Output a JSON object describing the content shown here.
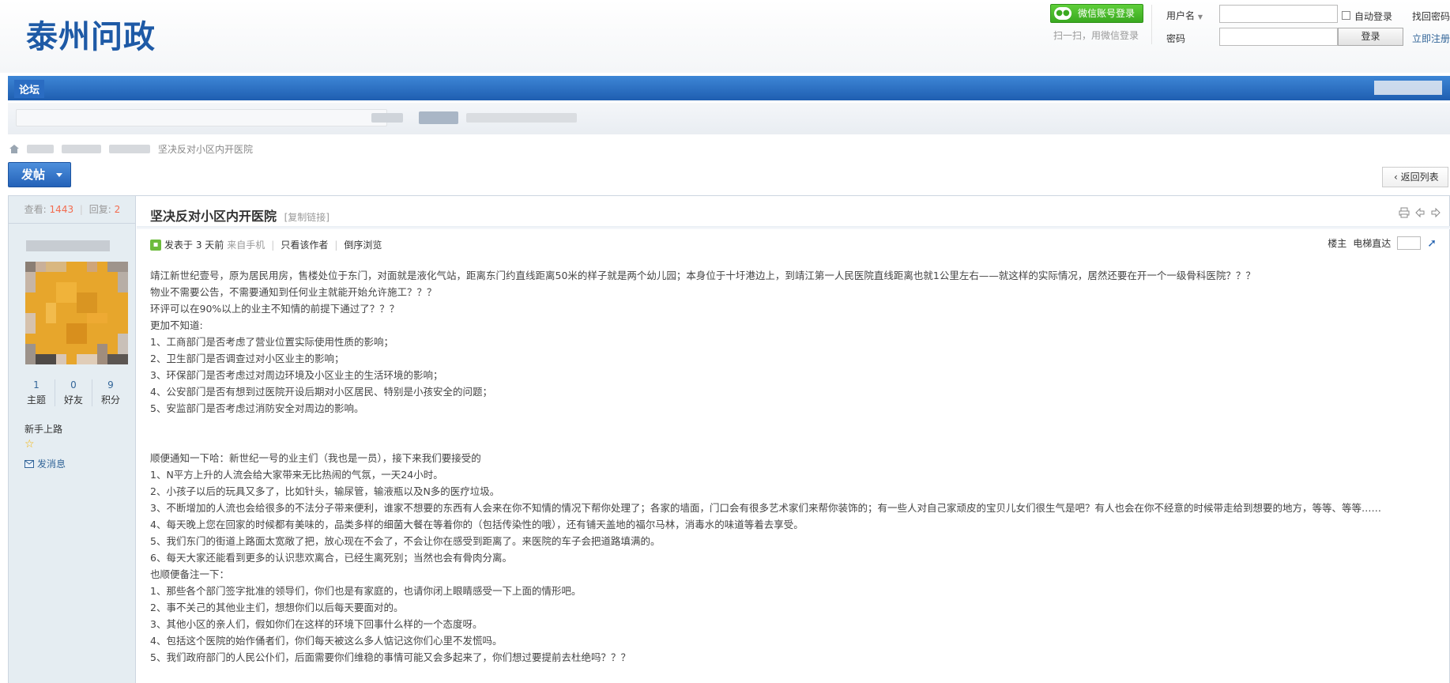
{
  "header": {
    "logo": "泰州问政",
    "wechat_login": "微信账号登录",
    "wechat_hint": "扫一扫，用微信登录",
    "username_label": "用户名",
    "password_label": "密码",
    "auto_login": "自动登录",
    "forgot_password": "找回密码",
    "login_button": "登录",
    "register": "立即注册"
  },
  "nav": {
    "forum": "论坛"
  },
  "breadcrumb": {
    "current": "坚决反对小区内开医院"
  },
  "toolbar": {
    "post_button": "发帖",
    "back_button": "返回列表"
  },
  "stats": {
    "views_label": "查看:",
    "views": "1443",
    "replies_label": "回复:",
    "replies": "2"
  },
  "author": {
    "counts": [
      {
        "value": "1",
        "label": "主题"
      },
      {
        "value": "0",
        "label": "好友"
      },
      {
        "value": "9",
        "label": "积分"
      }
    ],
    "rank": "新手上路",
    "send_message": "发消息"
  },
  "post": {
    "title": "坚决反对小区内开医院",
    "copy_link": "[复制链接]",
    "posted": "发表于 3 天前",
    "source": "来自手机",
    "only_author": "只看该作者",
    "reverse": "倒序浏览",
    "floor_owner": "楼主",
    "floor_jump": "电梯直达",
    "paragraphs": [
      "靖江新世纪壹号，原为居民用房，售楼处位于东门，对面就是液化气站，距离东门约直线距离50米的样子就是两个幼儿园；本身位于十圩港边上，到靖江第一人民医院直线距离也就1公里左右——就这样的实际情况，居然还要在开一个一级骨科医院？？？",
      "物业不需要公告，不需要通知到任何业主就能开始允许施工？？？",
      "环评可以在90%以上的业主不知情的前提下通过了？？？",
      "更加不知道:",
      "1、工商部门是否考虑了营业位置实际使用性质的影响；",
      "2、卫生部门是否调查过对小区业主的影响；",
      "3、环保部门是否考虑过对周边环境及小区业主的生活环境的影响；",
      "4、公安部门是否有想到过医院开设后期对小区居民、特别是小孩安全的问题；",
      "5、安监部门是否考虑过消防安全对周边的影响。",
      "",
      "",
      "顺便通知一下哈：新世纪一号的业主们（我也是一员），接下来我们要接受的",
      "1、N平方上升的人流会给大家带来无比热闹的气氛，一天24小时。",
      "2、小孩子以后的玩具又多了，比如针头，输尿管，输液瓶以及N多的医疗垃圾。",
      "3、不断增加的人流也会给很多的不法分子带来便利，谁家不想要的东西有人会来在你不知情的情况下帮你处理了；各家的墙面，门口会有很多艺术家们来帮你装饰的；有一些人对自己家顽皮的宝贝儿女们很生气是吧？有人也会在你不经意的时候带走给到想要的地方，等等、等等……",
      "4、每天晚上您在回家的时候都有美味的，品类多样的细菌大餐在等着你的（包括传染性的哦），还有铺天盖地的福尔马林，消毒水的味道等着去享受。",
      "5、我们东门的街道上路面太宽敞了把，放心现在不会了，不会让你在感受到距离了。来医院的车子会把道路填满的。",
      "6、每天大家还能看到更多的认识悲欢离合，已经生离死别；当然也会有骨肉分离。",
      "也顺便备注一下：",
      "1、那些各个部门签字批准的领导们，你们也是有家庭的，也请你闭上眼睛感受一下上面的情形吧。",
      "2、事不关己的其他业主们，想想你们以后每天要面对的。",
      "3、其他小区的亲人们，假如你们在这样的环境下回事什么样的一个态度呀。",
      "4、包括这个医院的始作俑者们，你们每天被这么多人惦记这你们心里不发慌吗。",
      "5、我们政府部门的人民公仆们，后面需要你们维稳的事情可能又会多起来了，你们想过要提前去杜绝吗？？？"
    ]
  },
  "colors": {
    "brand": "#1e5aa6",
    "nav": "#2462b8",
    "wechat": "#3aa920",
    "stat_number": "#f26c4f",
    "sidebar_bg": "#e5edf2"
  }
}
